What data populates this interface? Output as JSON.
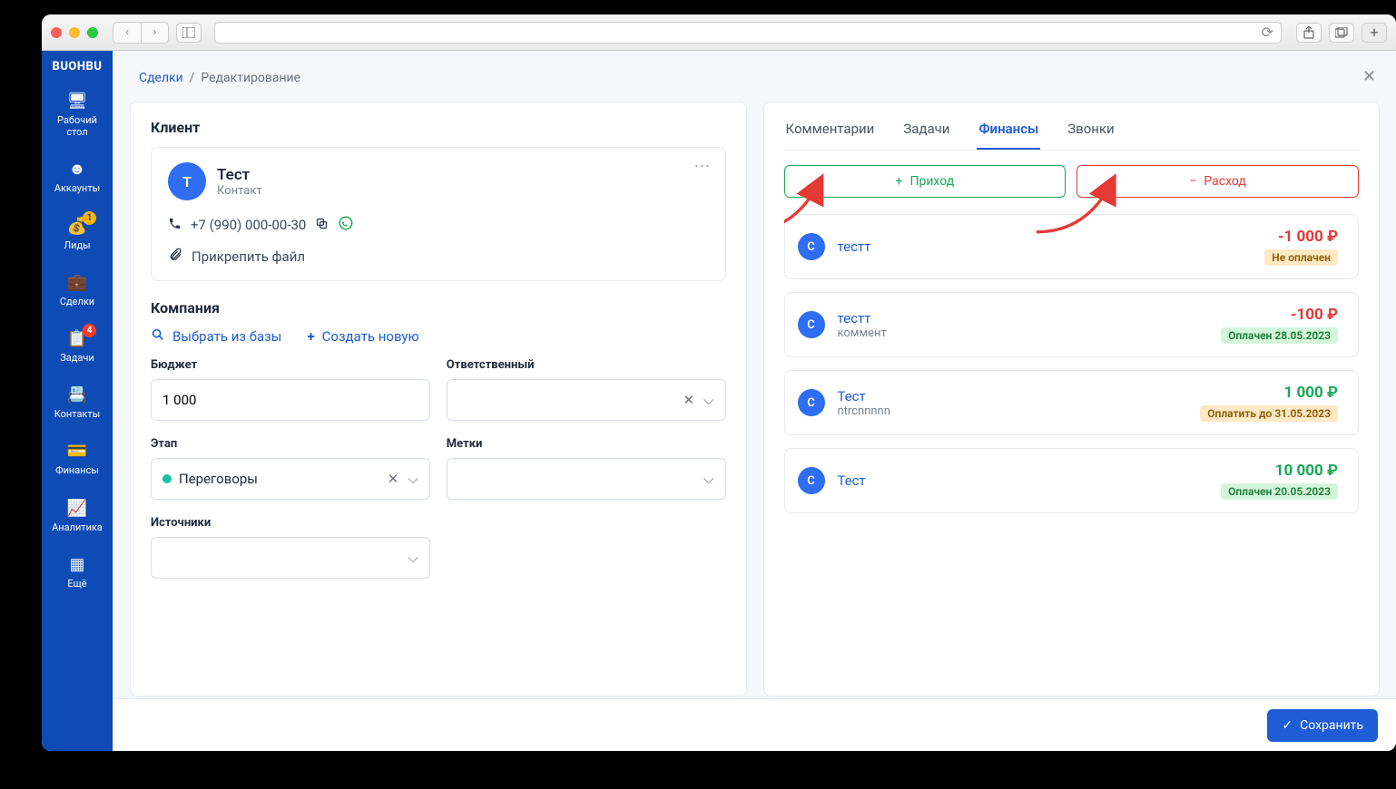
{
  "brand": "BUOHBU",
  "sidebar": {
    "items": [
      {
        "label": "Рабочий\nстол"
      },
      {
        "label": "Аккаунты"
      },
      {
        "label": "Лиды",
        "badge": "1"
      },
      {
        "label": "Сделки"
      },
      {
        "label": "Задачи",
        "badge": "4"
      },
      {
        "label": "Контакты"
      },
      {
        "label": "Финансы"
      },
      {
        "label": "Аналитика"
      },
      {
        "label": "Ещё"
      }
    ]
  },
  "breadcrumb": {
    "root": "Сделки",
    "current": "Редактирование"
  },
  "client_section": "Клиент",
  "client": {
    "avatar": "Т",
    "name": "Тест",
    "subtitle": "Контакт",
    "phone": "+7 (990) 000-00-30",
    "attach": "Прикрепить файл"
  },
  "company_section": "Компания",
  "company": {
    "select_label": "Выбрать из базы",
    "create_label": "Создать новую"
  },
  "fields": {
    "budget_label": "Бюджет",
    "budget_value": "1 000",
    "responsible_label": "Ответственный",
    "stage_label": "Этап",
    "stage_value": "Переговоры",
    "tags_label": "Метки",
    "sources_label": "Источники"
  },
  "tabs": {
    "comments": "Комментарии",
    "tasks": "Задачи",
    "finance": "Финансы",
    "calls": "Звонки"
  },
  "finance_buttons": {
    "income": "Приход",
    "expense": "Расход"
  },
  "finance_items": [
    {
      "avatar": "С",
      "title": "тестт",
      "sub": "",
      "amount": "-1 000 ₽",
      "sign": "neg",
      "pill": "Не оплачен",
      "pill_class": "unpaid"
    },
    {
      "avatar": "С",
      "title": "тестт",
      "sub": "коммент",
      "amount": "-100 ₽",
      "sign": "neg",
      "pill": "Оплачен 28.05.2023",
      "pill_class": "paid"
    },
    {
      "avatar": "С",
      "title": "Тест",
      "sub": "ntrcnnnnn",
      "amount": "1 000 ₽",
      "sign": "pos",
      "pill": "Оплатить до 31.05.2023",
      "pill_class": "due"
    },
    {
      "avatar": "С",
      "title": "Тест",
      "sub": "",
      "amount": "10 000 ₽",
      "sign": "pos",
      "pill": "Оплачен 20.05.2023",
      "pill_class": "paid"
    }
  ],
  "save_label": "Сохранить"
}
